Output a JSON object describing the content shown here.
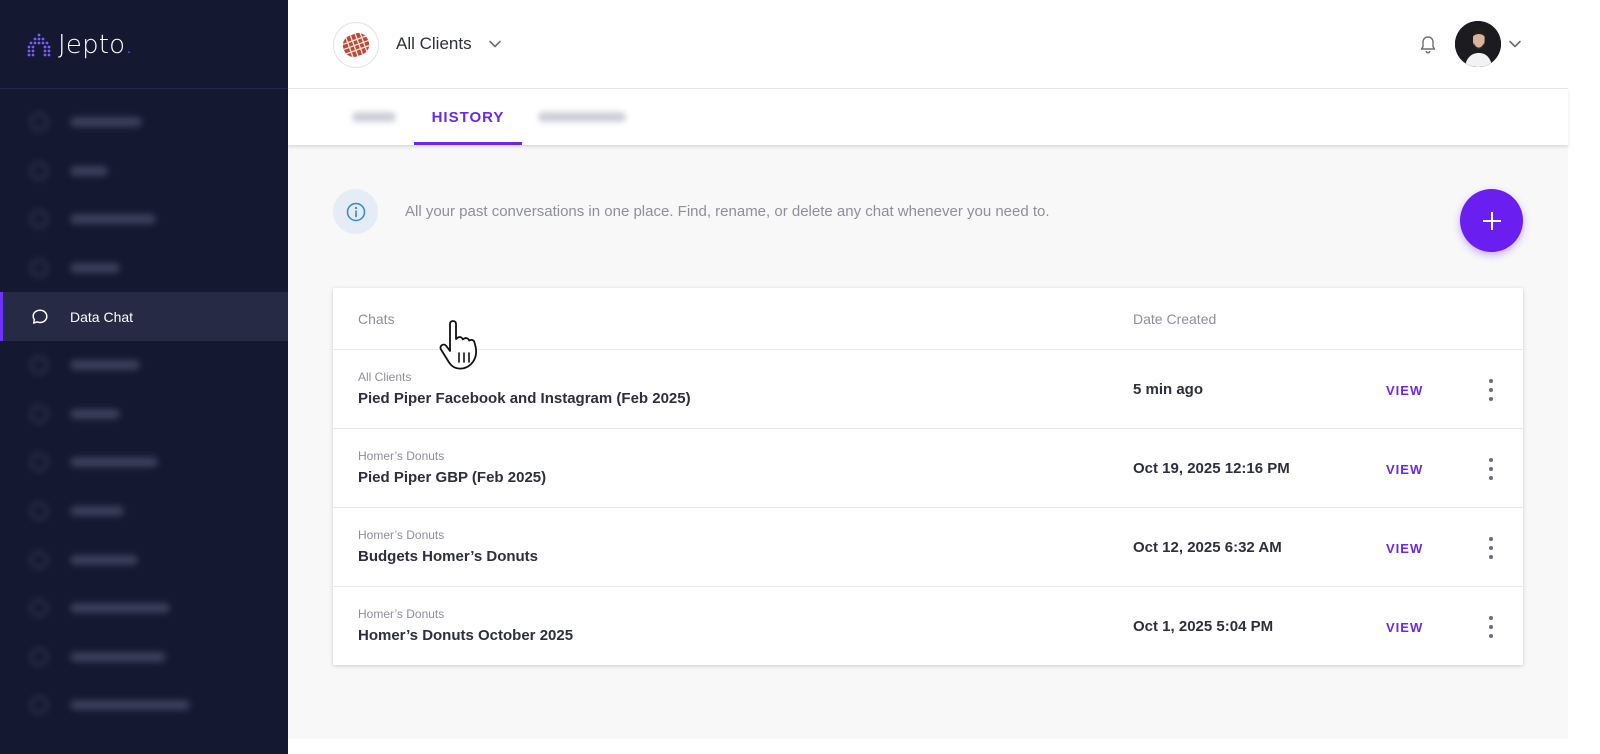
{
  "app": {
    "logo_text": "Jepto",
    "logo_dot": ".",
    "accent_color": "#6a28e8",
    "sidebar_color": "#141830"
  },
  "sidebar": {
    "items": [
      {
        "label": "",
        "blurred": true
      },
      {
        "label": "",
        "blurred": true
      },
      {
        "label": "",
        "blurred": true
      },
      {
        "label": "",
        "blurred": true
      },
      {
        "label": "Data Chat",
        "icon": "chat-bubble-icon",
        "active": true
      },
      {
        "label": "",
        "blurred": true
      },
      {
        "label": "",
        "blurred": true
      },
      {
        "label": "",
        "blurred": true
      },
      {
        "label": "",
        "blurred": true
      },
      {
        "label": "",
        "blurred": true
      },
      {
        "label": "",
        "blurred": true
      },
      {
        "label": "",
        "blurred": true
      },
      {
        "label": "",
        "blurred": true
      }
    ]
  },
  "header": {
    "client_selector": "All Clients",
    "icons": [
      "bell-icon",
      "user-avatar",
      "chevron-down-icon"
    ]
  },
  "tabs": [
    {
      "label": "",
      "blurred": true
    },
    {
      "label": "HISTORY",
      "active": true
    },
    {
      "label": "",
      "blurred": true
    }
  ],
  "info": {
    "text": "All your past conversations in one place. Find, rename, or delete any chat whenever you need to."
  },
  "new_chat_button": {
    "icon": "plus-icon"
  },
  "table": {
    "columns": {
      "chats": "Chats",
      "date_created": "Date Created"
    },
    "rows": [
      {
        "client": "All Clients",
        "title": "Pied Piper Facebook and Instagram (Feb 2025)",
        "date": "5 min ago",
        "action": "VIEW"
      },
      {
        "client": "Homer’s Donuts",
        "title": "Pied Piper GBP (Feb 2025)",
        "date": "Oct 19, 2025 12:16 PM",
        "action": "VIEW"
      },
      {
        "client": "Homer’s Donuts",
        "title": "Budgets Homer’s Donuts",
        "date": "Oct 12, 2025 6:32 AM",
        "action": "VIEW"
      },
      {
        "client": "Homer’s Donuts",
        "title": "Homer’s Donuts October 2025",
        "date": "Oct 1, 2025 5:04 PM",
        "action": "VIEW"
      }
    ]
  }
}
